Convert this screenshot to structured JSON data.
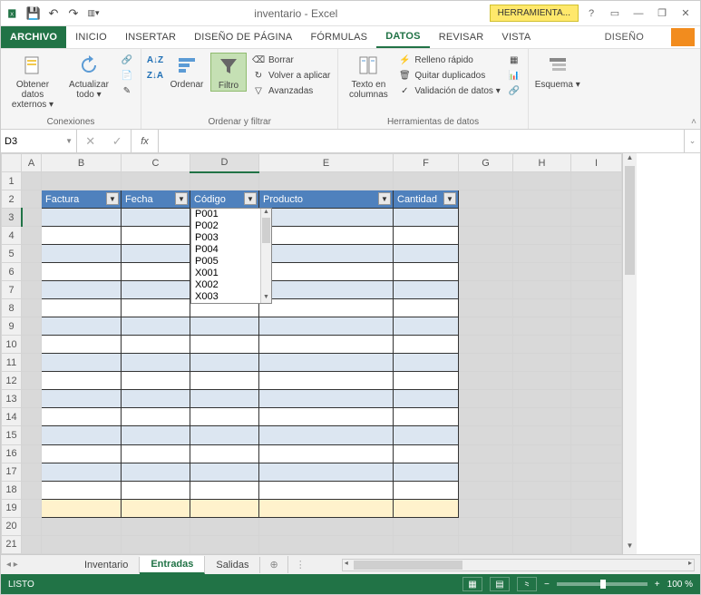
{
  "titlebar": {
    "title": "inventario - Excel",
    "tool_tab": "HERRAMIENTA..."
  },
  "tabs": {
    "file": "ARCHIVO",
    "inicio": "INICIO",
    "insertar": "INSERTAR",
    "diseno_pagina": "DISEÑO DE PÁGINA",
    "formulas": "FÓRMULAS",
    "datos": "DATOS",
    "revisar": "REVISAR",
    "vista": "VISTA",
    "diseno": "DISEÑO"
  },
  "ribbon": {
    "conexiones": {
      "obtener": "Obtener datos externos ▾",
      "actualizar": "Actualizar todo ▾",
      "label": "Conexiones"
    },
    "ordenar_filtrar": {
      "ordenar": "Ordenar",
      "filtro": "Filtro",
      "borrar": "Borrar",
      "volver": "Volver a aplicar",
      "avanzadas": "Avanzadas",
      "label": "Ordenar y filtrar"
    },
    "herramientas": {
      "texto_cols": "Texto en columnas",
      "relleno": "Relleno rápido",
      "quitar_dup": "Quitar duplicados",
      "validacion": "Validación de datos ▾",
      "label": "Herramientas de datos"
    },
    "esquema": {
      "btn": "Esquema ▾"
    }
  },
  "namebox": "D3",
  "table": {
    "headers": [
      "Factura",
      "Fecha",
      "Código",
      "Producto",
      "Cantidad"
    ]
  },
  "dropdown": {
    "items": [
      "P001",
      "P002",
      "P003",
      "P004",
      "P005",
      "X001",
      "X002",
      "X003"
    ]
  },
  "sheets": {
    "inv": "Inventario",
    "ent": "Entradas",
    "sal": "Salidas"
  },
  "status": {
    "ready": "LISTO",
    "zoom": "100 %"
  },
  "cols": [
    "A",
    "B",
    "C",
    "D",
    "E",
    "F",
    "G",
    "H",
    "I"
  ]
}
